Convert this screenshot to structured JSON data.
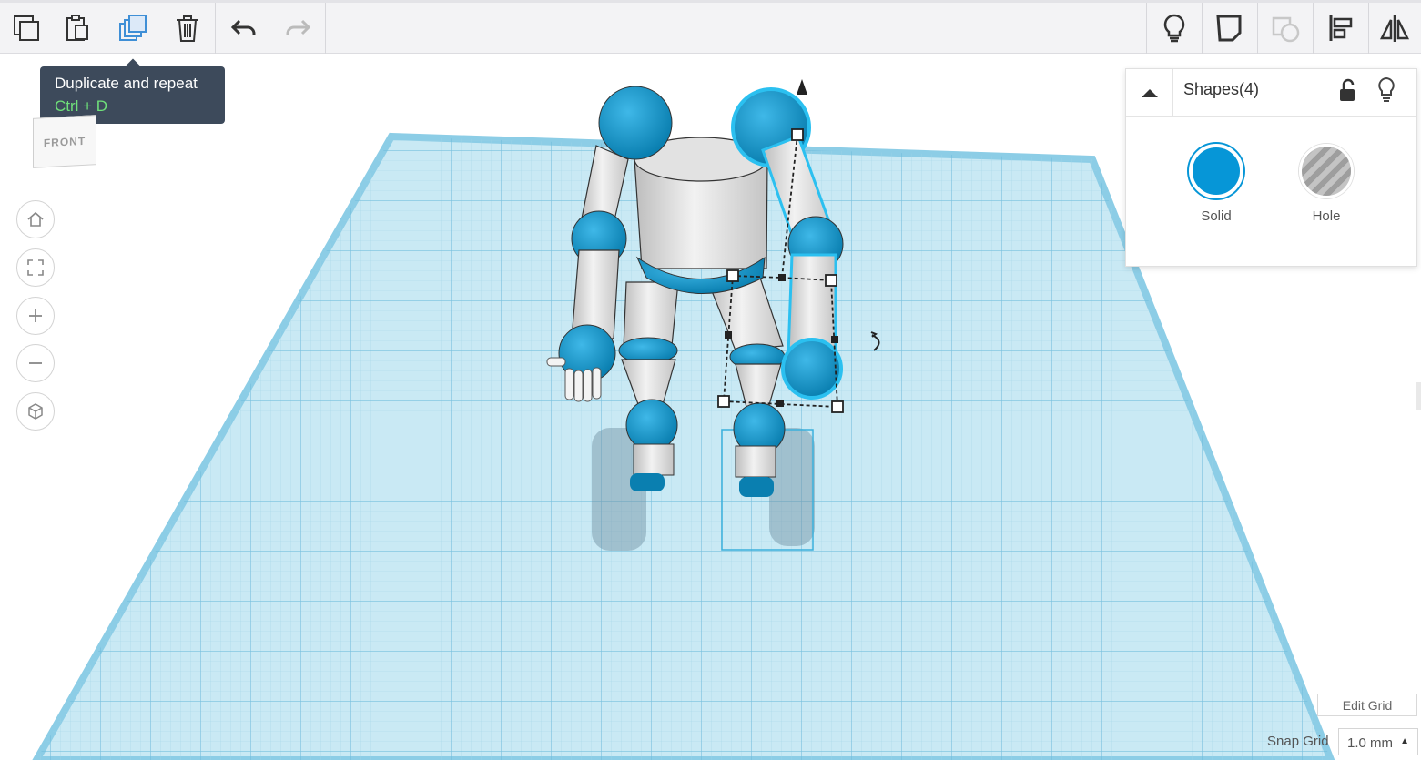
{
  "toolbar": {
    "left_tools": [
      "copy-icon",
      "paste-icon",
      "duplicate-icon",
      "delete-icon",
      "undo-icon",
      "redo-icon"
    ],
    "right_tools": [
      "lightbulb-icon",
      "note-icon",
      "group-icon",
      "align-icon",
      "mirror-icon"
    ]
  },
  "tooltip": {
    "title": "Duplicate and repeat",
    "shortcut": "Ctrl + D"
  },
  "viewcube": {
    "face_label": "FRONT"
  },
  "nav_buttons": [
    "home-icon",
    "fit-icon",
    "zoom-in-icon",
    "zoom-out-icon",
    "perspective-icon"
  ],
  "shape_panel": {
    "title": "Shapes(4)",
    "solid_label": "Solid",
    "hole_label": "Hole",
    "solid_color": "#0696d7"
  },
  "grid": {
    "edit_label": "Edit Grid",
    "snap_label": "Snap Grid",
    "snap_value": "1.0 mm"
  },
  "colors": {
    "workplane": "#bfe3ef",
    "grid_line": "#7cc4e0",
    "shape_blue": "#0a93c6",
    "shape_white": "#e8e8e8"
  }
}
